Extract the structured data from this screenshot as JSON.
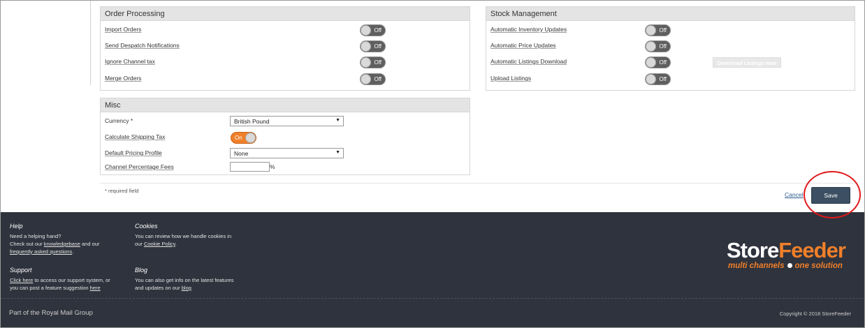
{
  "order_processing": {
    "title": "Order Processing",
    "rows": [
      {
        "label": "Import Orders",
        "state": "Off"
      },
      {
        "label": "Send Despatch Notifications",
        "state": "Off"
      },
      {
        "label": "Ignore Channel tax",
        "state": "Off"
      },
      {
        "label": "Merge Orders",
        "state": "Off"
      }
    ]
  },
  "stock_management": {
    "title": "Stock Management",
    "rows": [
      {
        "label": "Automatic Inventory Updates",
        "state": "Off"
      },
      {
        "label": "Automatic Price Updates",
        "state": "Off"
      },
      {
        "label": "Automatic Listings Download",
        "state": "Off"
      },
      {
        "label": "Upload Listings",
        "state": "Off"
      }
    ],
    "download_button": "Download Listings Now"
  },
  "misc": {
    "title": "Misc",
    "currency_label": "Currency *",
    "currency_value": "British Pound",
    "shipping_tax_label": "Calculate Shipping Tax",
    "shipping_tax_state": "On",
    "pricing_profile_label": "Default Pricing Profile",
    "pricing_profile_value": "None",
    "fees_label": "Channel Percentage Fees",
    "fees_value": "",
    "fees_unit": "%"
  },
  "form": {
    "required_note": "* required field",
    "cancel_label": "Cancel",
    "save_label": "Save"
  },
  "footer": {
    "help": {
      "title": "Help",
      "line1": "Need a helping hand?",
      "line2_pre": "Check out our ",
      "link_kb": "knowledgebase",
      "line2_mid": " and our",
      "link_faq": "frequently asked questions",
      "line3_post": "."
    },
    "cookies": {
      "title": "Cookies",
      "line1": "You can review how we handle cookies in",
      "line2_pre": "our ",
      "link": "Cookie Policy",
      "line2_post": "."
    },
    "support": {
      "title": "Support",
      "link_click": "Click here",
      "line1_post": " to access our support system, or",
      "line2_pre": "you can post a feature suggestion ",
      "link_here": "here"
    },
    "blog": {
      "title": "Blog",
      "line1": "You can also get info on the latest features",
      "line2_pre": "and updates on our ",
      "link": "blog"
    },
    "group_text": "Part of the Royal Mail Group",
    "copyright": "Copyright © 2018 StoreFeeder",
    "logo": {
      "store": "Store",
      "feeder": "Feeder",
      "tagline_left": "multi channels",
      "tagline_right": "one solution"
    }
  },
  "colors": {
    "accent": "#f07f2a",
    "footer_bg": "#2f333d",
    "save_button": "#3c4f63",
    "highlight": "#e0191b"
  }
}
